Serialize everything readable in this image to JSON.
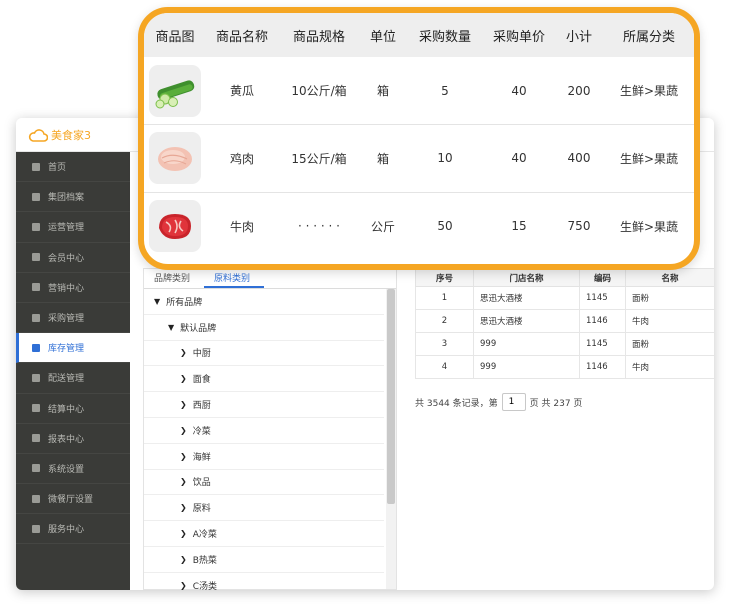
{
  "app": {
    "logo_text": "美食家3"
  },
  "sidebar": {
    "items": [
      {
        "label": "首页",
        "icon": "home-icon"
      },
      {
        "label": "集团档案",
        "icon": "file-icon"
      },
      {
        "label": "运营管理",
        "icon": "bar-chart-icon"
      },
      {
        "label": "会员中心",
        "icon": "member-card-icon"
      },
      {
        "label": "营销中心",
        "icon": "edit-icon"
      },
      {
        "label": "采购管理",
        "icon": "cart-icon"
      },
      {
        "label": "库存管理",
        "icon": "inventory-icon",
        "active": true
      },
      {
        "label": "配送管理",
        "icon": "truck-icon"
      },
      {
        "label": "结算中心",
        "icon": "money-icon"
      },
      {
        "label": "报表中心",
        "icon": "report-icon"
      },
      {
        "label": "系统设置",
        "icon": "gear-icon"
      },
      {
        "label": "微餐厅设置",
        "icon": "fork-knife-icon"
      },
      {
        "label": "服务中心",
        "icon": "service-icon"
      }
    ]
  },
  "tree": {
    "tabs": [
      "品牌类别",
      "原料类别"
    ],
    "rows": [
      {
        "label": "所有品牌",
        "caret": "down",
        "level": 0
      },
      {
        "label": "默认品牌",
        "caret": "down",
        "level": 1
      },
      {
        "label": "中厨",
        "caret": "right",
        "level": 2
      },
      {
        "label": "面食",
        "caret": "right",
        "level": 2
      },
      {
        "label": "西厨",
        "caret": "right",
        "level": 2
      },
      {
        "label": "冷菜",
        "caret": "right",
        "level": 2
      },
      {
        "label": "海鲜",
        "caret": "right",
        "level": 2
      },
      {
        "label": "饮品",
        "caret": "right",
        "level": 2
      },
      {
        "label": "原料",
        "caret": "right",
        "level": 2
      },
      {
        "label": "A冷菜",
        "caret": "right",
        "level": 2
      },
      {
        "label": "B热菜",
        "caret": "right",
        "level": 2
      },
      {
        "label": "C汤类",
        "caret": "right",
        "level": 2
      }
    ]
  },
  "grid": {
    "headers": [
      "序号",
      "门店名称",
      "编码",
      "名称"
    ],
    "rows": [
      [
        "1",
        "思迅大酒楼",
        "1145",
        "面粉"
      ],
      [
        "2",
        "思迅大酒楼",
        "1146",
        "牛肉"
      ],
      [
        "3",
        "999",
        "1145",
        "面粉"
      ],
      [
        "4",
        "999",
        "1146",
        "牛肉"
      ]
    ],
    "pager": {
      "prefix": "共 3544 条记录，第",
      "page": "1",
      "suffix": "页 共 237 页"
    }
  },
  "popup": {
    "headers": [
      "商品图",
      "商品名称",
      "商品规格",
      "单位",
      "采购数量",
      "采购单价",
      "小计",
      "所属分类"
    ],
    "rows": [
      {
        "image": "cucumber-image",
        "name": "黄瓜",
        "spec": "10公斤/箱",
        "unit": "箱",
        "qty": "5",
        "price": "40",
        "subtotal": "200",
        "category": "生鲜>果蔬"
      },
      {
        "image": "chicken-image",
        "name": "鸡肉",
        "spec": "15公斤/箱",
        "unit": "箱",
        "qty": "10",
        "price": "40",
        "subtotal": "400",
        "category": "生鲜>果蔬"
      },
      {
        "image": "beef-image",
        "name": "牛肉",
        "spec": "· · · · · ·",
        "unit": "公斤",
        "qty": "50",
        "price": "15",
        "subtotal": "750",
        "category": "生鲜>果蔬"
      }
    ],
    "colors": {
      "highlight_border": "#f5a623",
      "header_bg": "#eeeeee"
    }
  }
}
